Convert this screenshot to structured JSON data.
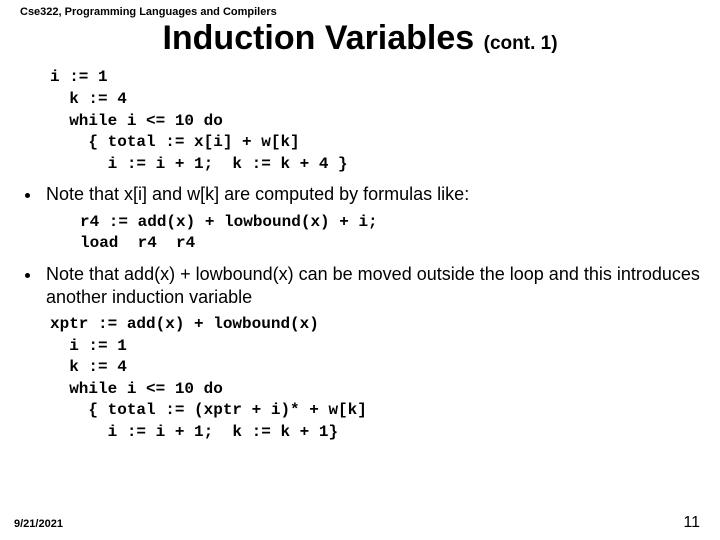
{
  "course": "Cse322, Programming Languages and Compilers",
  "title_main": "Induction Variables ",
  "title_cont": "(cont. 1)",
  "code_block_1": "i := 1\n  k := 4\n  while i <= 10 do\n    { total := x[i] + w[k]\n      i := i + 1;  k := k + 4 }",
  "bullet_1": "Note that x[i]  and w[k] are computed by formulas like:",
  "code_block_2": "r4 := add(x) + lowbound(x) + i;\nload  r4  r4",
  "bullet_2": "Note that add(x) + lowbound(x) can be moved outside the loop and this introduces another induction variable",
  "code_block_3": "xptr := add(x) + lowbound(x)\n  i := 1\n  k := 4\n  while i <= 10 do\n    { total := (xptr + i)* + w[k]\n      i := i + 1;  k := k + 1}",
  "footer_date": "9/21/2021",
  "footer_page": "11"
}
